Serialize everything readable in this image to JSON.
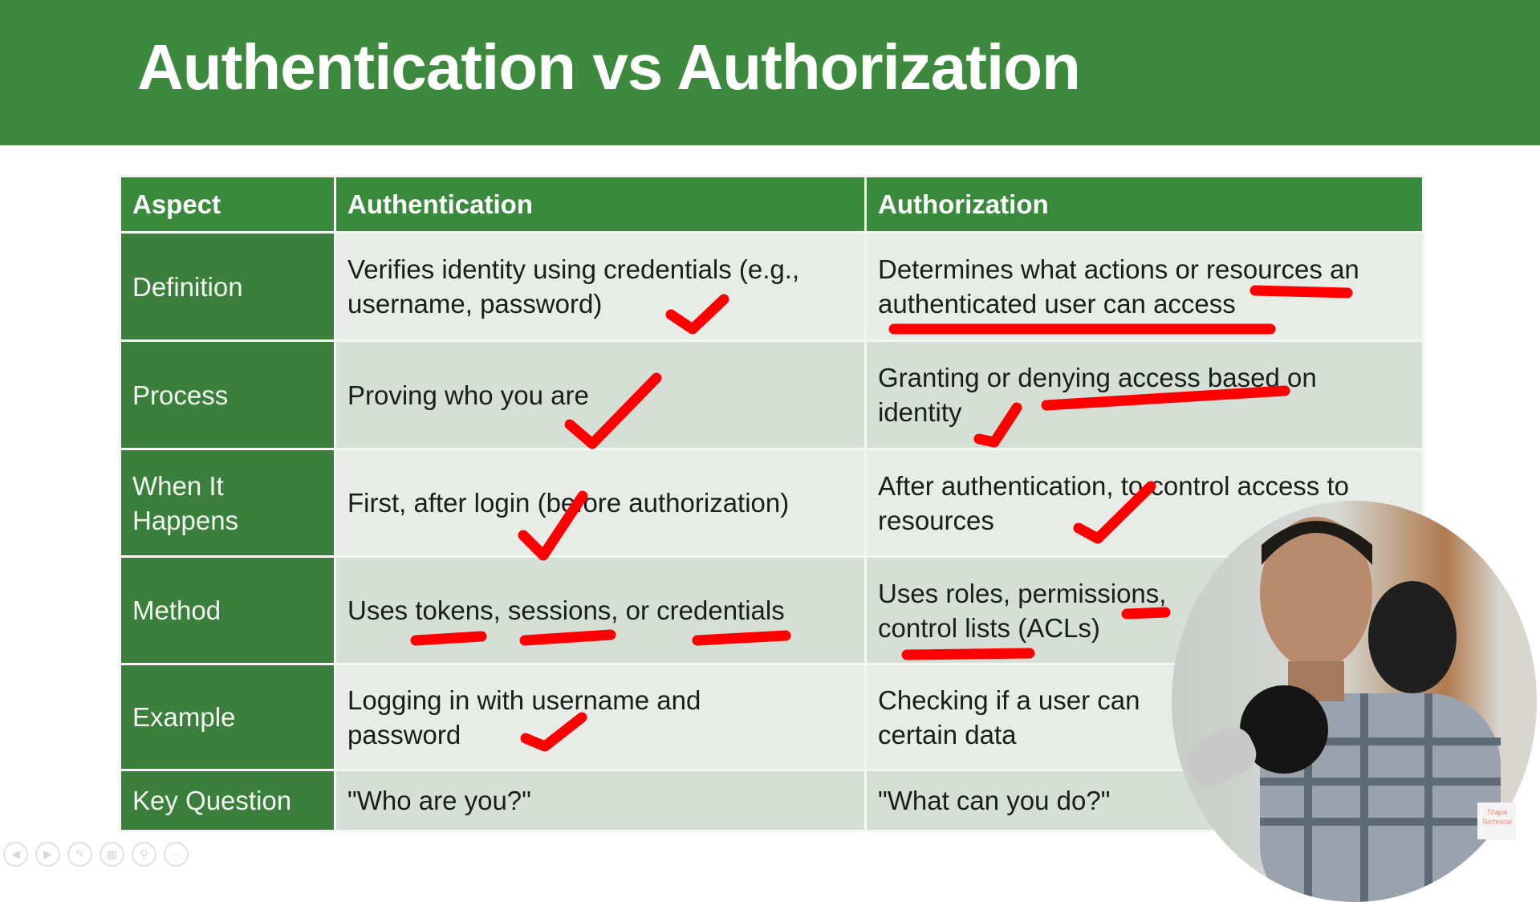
{
  "slide": {
    "title": "Authentication vs Authorization",
    "headers": [
      "Aspect",
      "Authentication",
      "Authorization"
    ],
    "rows": [
      {
        "aspect": "Definition",
        "authentication": "Verifies identity using credentials (e.g.,\nusername, password)",
        "authorization": "Determines what actions or resources an\nauthenticated user can access"
      },
      {
        "aspect": "Process",
        "authentication": "Proving who you are",
        "authorization": "Granting or denying access based on\nidentity"
      },
      {
        "aspect": "When It\nHappens",
        "authentication": "First, after login (before authorization)",
        "authorization": "After authentication, to control access to\nresources"
      },
      {
        "aspect": "Method",
        "authentication": "Uses tokens, sessions, or credentials",
        "authorization": "Uses roles, permissions,\ncontrol lists (ACLs)"
      },
      {
        "aspect": "Example",
        "authentication": "Logging in with username and\npassword",
        "authorization": "Checking if a user can\ncertain data"
      },
      {
        "aspect": "Key Question",
        "authentication": "\"Who are you?\"",
        "authorization": "\"What can you do?\""
      }
    ]
  },
  "annotation_color": "#ff0000",
  "watermark": "Thapa Technical",
  "toolbar": {
    "icons": [
      "previous-icon",
      "next-icon",
      "pen-icon",
      "slides-icon",
      "zoom-icon",
      "more-icon"
    ]
  }
}
